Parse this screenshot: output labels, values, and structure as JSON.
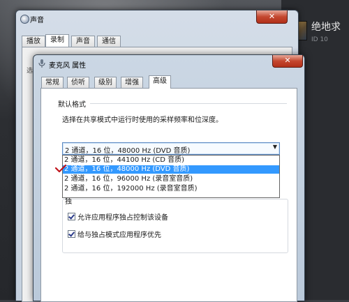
{
  "outer_window": {
    "title": "声音",
    "close_glyph": "✕",
    "tabs": [
      "播放",
      "录制",
      "声音",
      "通信"
    ],
    "active_tab": 1,
    "panel_edge_char": "选"
  },
  "inner_window": {
    "title": "麦克风 属性",
    "close_glyph": "✕",
    "tabs": [
      "常规",
      "侦听",
      "级别",
      "增强",
      "高级"
    ],
    "active_tab": 4,
    "default_format": {
      "group_label": "默认格式",
      "description": "选择在共享模式中运行时使用的采样频率和位深度。",
      "selected_value": "2 通道，16 位，48000 Hz (DVD 音质)",
      "arrow_glyph": "▼",
      "options": [
        "2 通道，16 位，44100 Hz (CD 音质)",
        "2 通道，16 位，48000 Hz (DVD 音质)",
        "2 通道，16 位，96000 Hz (录音室音质)",
        "2 通道，16 位，192000 Hz (录音室音质)"
      ],
      "highlighted_option": 1
    },
    "exclusive_mode": {
      "group_label_fragment": "独",
      "checkboxes": [
        {
          "label": "允许应用程序独占控制该设备",
          "checked": true
        },
        {
          "label": "给与独占模式应用程序优先",
          "checked": true
        }
      ]
    }
  },
  "side_panel": {
    "name": "绝地求",
    "id_text": "ID 10"
  },
  "colors": {
    "selection": "#3399ff",
    "close_button": "#c4472f",
    "annotation_check": "#c0141c"
  }
}
